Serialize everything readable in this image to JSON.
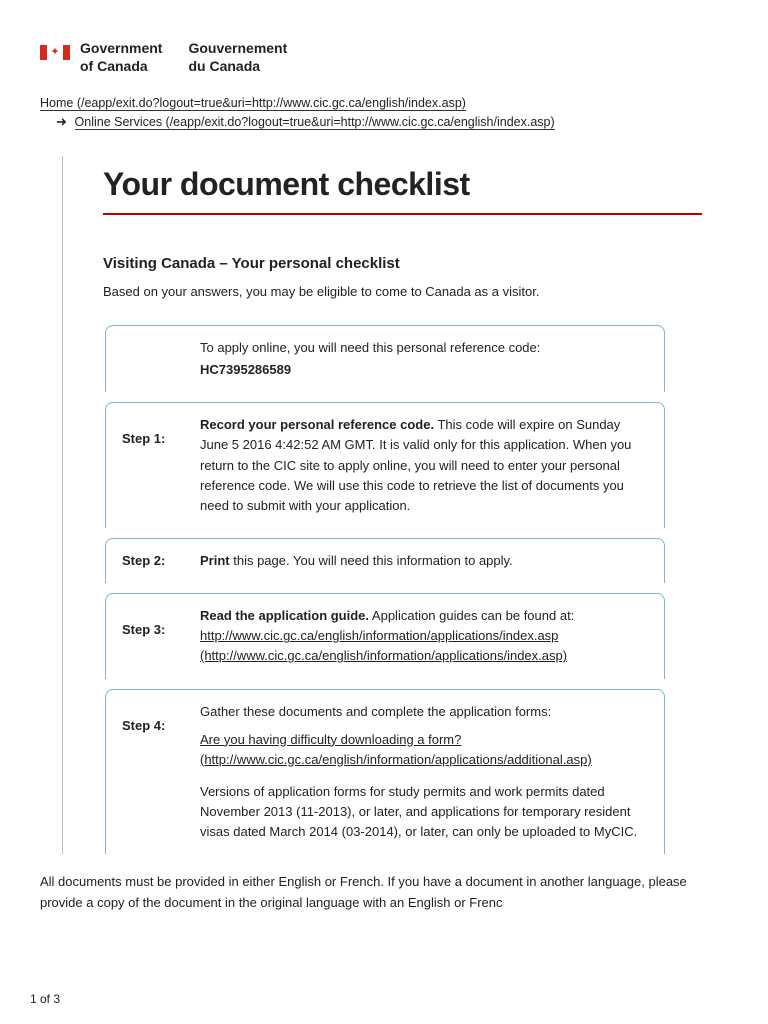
{
  "header": {
    "gov_en_line1": "Government",
    "gov_en_line2": "of Canada",
    "gov_fr_line1": "Gouvernement",
    "gov_fr_line2": "du Canada"
  },
  "breadcrumb": {
    "home": "Home (/eapp/exit.do?logout=true&uri=http://www.cic.gc.ca/english/index.asp)",
    "arrow": "➜",
    "online": "Online Services (/eapp/exit.do?logout=true&uri=http://www.cic.gc.ca/english/index.asp)"
  },
  "page": {
    "title": "Your document checklist",
    "subtitle": "Visiting Canada – Your personal checklist",
    "intro": "Based on your answers, you may be eligible to come to Canada as a visitor."
  },
  "refbox": {
    "prompt": "To apply online, you will need this personal reference code:",
    "code": "HC7395286589"
  },
  "steps": {
    "s1_label": "Step 1:",
    "s1_bold": "Record your personal reference code.",
    "s1_rest": " This code will expire on Sunday June 5 2016 4:42:52 AM GMT. It is valid only for this application. When you return to the CIC site to apply online, you will need to enter your personal reference code. We will use this code to retrieve the list of documents you need to submit with your application.",
    "s2_label": "Step 2:",
    "s2_bold": "Print",
    "s2_rest": " this page. You will need this information to apply.",
    "s3_label": "Step 3:",
    "s3_bold": "Read the application guide.",
    "s3_rest": "  Application guides can be found at: ",
    "s3_link": "http://www.cic.gc.ca/english/information/applications/index.asp (http://www.cic.gc.ca/english/information/applications/index.asp)",
    "s4_label": "Step 4:",
    "s4_line1": "Gather these documents and complete the application forms:",
    "s4_link": "Are you having difficulty downloading a form? (http://www.cic.gc.ca/english/information/applications/additional.asp)",
    "s4_line3": "Versions of application forms for study permits and work permits dated November 2013 (11-2013), or later, and applications for temporary resident visas dated March 2014 (03-2014), or later, can only be uploaded to MyCIC."
  },
  "footer": {
    "note": "All documents must be provided in either English or French. If you have a document in another language, please provide a copy of the document in the original language with an English or Frenc",
    "page_num": "1 of 3"
  }
}
